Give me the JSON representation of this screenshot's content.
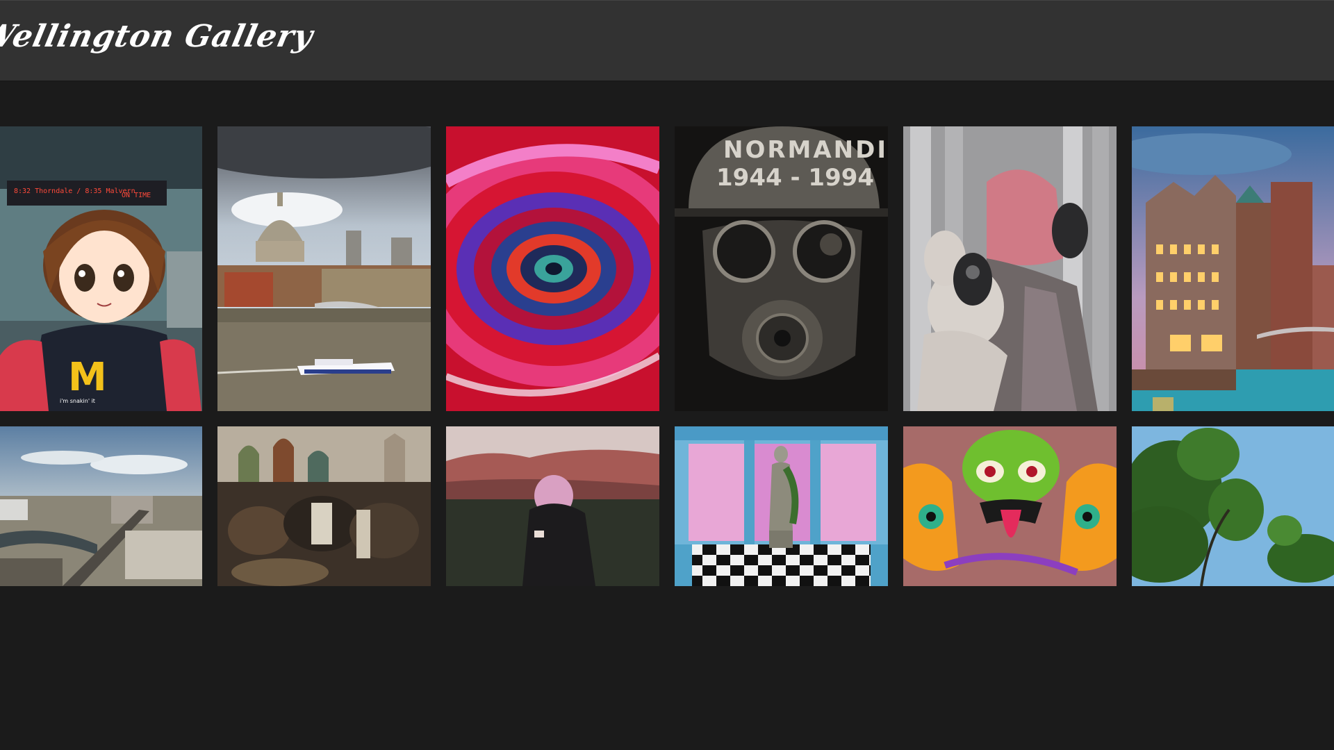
{
  "header": {
    "title": "Wellington Gallery"
  },
  "colors": {
    "header_bg": "#323232",
    "page_bg": "#1b1b1b",
    "title": "#ffffff"
  },
  "tiles": [
    {
      "name": "anime-girl-mcdonalds",
      "sign_text": "8:32 Thorndale / 8:35 Malvern",
      "board_text": "ON TIME",
      "shirt_text": "i'm snakin' it"
    },
    {
      "name": "london-st-pauls-thames"
    },
    {
      "name": "abstract-swirl"
    },
    {
      "name": "gas-mask-soldier",
      "helmet_line1": "NORMANDIE",
      "helmet_line2": "1944 - 1994"
    },
    {
      "name": "pink-hair-gas-mask"
    },
    {
      "name": "hamburg-speicherstadt-dusk"
    },
    {
      "name": "moscow-aerial-river"
    },
    {
      "name": "russian-painting-crowd"
    },
    {
      "name": "pink-hair-girl-hills"
    },
    {
      "name": "vaporwave-statue-checkerboard"
    },
    {
      "name": "psychedelic-monster"
    },
    {
      "name": "tree-blue-sky"
    }
  ]
}
